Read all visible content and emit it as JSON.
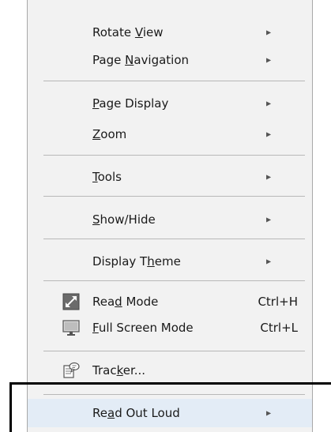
{
  "menu": {
    "items": [
      {
        "pre": "Rotate ",
        "key": "V",
        "post": "iew",
        "arrow": "▶"
      },
      {
        "pre": "Page ",
        "key": "N",
        "post": "avigation",
        "arrow": "▶"
      },
      {
        "pre": "",
        "key": "P",
        "post": "age Display",
        "arrow": "▶"
      },
      {
        "pre": "",
        "key": "Z",
        "post": "oom",
        "arrow": "▶"
      },
      {
        "pre": "",
        "key": "T",
        "post": "ools",
        "arrow": "▶"
      },
      {
        "pre": "",
        "key": "S",
        "post": "how/Hide",
        "arrow": "▶"
      },
      {
        "pre": "Display T",
        "key": "h",
        "post": "eme",
        "arrow": "▶"
      },
      {
        "pre": "Rea",
        "key": "d",
        "post": " Mode",
        "shortcut": "Ctrl+H",
        "icon": "read-mode-icon"
      },
      {
        "pre": "",
        "key": "F",
        "post": "ull Screen Mode",
        "shortcut": "Ctrl+L",
        "icon": "full-screen-icon"
      },
      {
        "pre": "Trac",
        "key": "k",
        "post": "er...",
        "icon": "tracker-icon"
      },
      {
        "pre": "Re",
        "key": "a",
        "post": "d Out Loud",
        "arrow": "▶"
      }
    ]
  },
  "colors": {
    "menu_background": "#f2f2f2",
    "highlight": "#e3ecf6",
    "separator": "#b8b8b8",
    "callout_border": "#000000"
  }
}
